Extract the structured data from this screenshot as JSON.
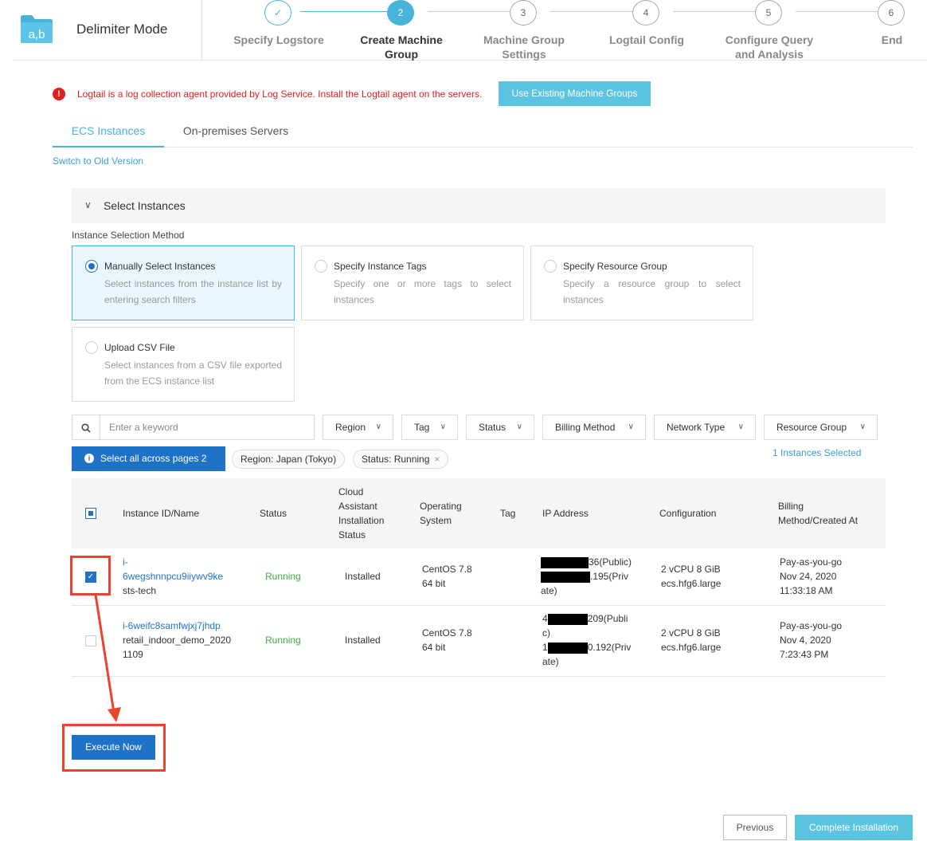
{
  "header": {
    "title": "Delimiter Mode",
    "logo_text": "a,b"
  },
  "steps": [
    {
      "num": "✓",
      "label": "Specify Logstore"
    },
    {
      "num": "2",
      "label": "Create Machine Group"
    },
    {
      "num": "3",
      "label": "Machine Group Settings"
    },
    {
      "num": "4",
      "label": "Logtail Config"
    },
    {
      "num": "5",
      "label": "Configure Query and Analysis"
    },
    {
      "num": "6",
      "label": "End"
    }
  ],
  "alert": {
    "icon": "!",
    "text": "Logtail is a log collection agent provided by Log Service. Install the Logtail agent on the servers.",
    "button": "Use Existing Machine Groups"
  },
  "tabs": [
    "ECS Instances",
    "On-premises Servers"
  ],
  "switch_link": "Switch to Old Version",
  "select_panel": {
    "title": "Select Instances",
    "method_label": "Instance Selection Method",
    "methods": [
      {
        "title": "Manually Select Instances",
        "desc": "Select instances from the instance list by entering search filters"
      },
      {
        "title": "Specify Instance Tags",
        "desc": "Specify one or more tags to select instances"
      },
      {
        "title": "Specify Resource Group",
        "desc": "Specify a resource group to select instances"
      },
      {
        "title": "Upload CSV File",
        "desc": "Select instances from a CSV file exported from the ECS instance list"
      }
    ]
  },
  "filters": {
    "search_placeholder": "Enter a keyword",
    "dropdowns": [
      "Region",
      "Tag",
      "Status",
      "Billing Method",
      "Network Type",
      "Resource Group"
    ]
  },
  "select_all_button": "Select all across pages 2",
  "chips": [
    "Region: Japan (Tokyo)",
    "Status: Running"
  ],
  "selected_count": "1 Instances Selected",
  "table": {
    "headers": {
      "id": "Instance ID/Name",
      "status": "Status",
      "cloud": "Cloud Assistant Installation Status",
      "os": "Operating System",
      "tag": "Tag",
      "ip": "IP Address",
      "config": "Configuration",
      "billing": "Billing Method/Created At"
    },
    "rows": [
      {
        "checked": true,
        "id_line1": "i-",
        "id_line2": "6wegshnnpcu9iiywv9ke",
        "name": "sts-tech",
        "status": "Running",
        "cloud": "Installed",
        "os_line1": "CentOS 7.8",
        "os_line2": "64 bit",
        "ip_line1": "36(Public)",
        "ip_line2": ".195(Priv",
        "ip_line3": "ate)",
        "cfg_line1": "2 vCPU 8 GiB",
        "cfg_line2": "ecs.hfg6.large",
        "bill_line1": "Pay-as-you-go",
        "bill_line2": "Nov 24, 2020",
        "bill_line3": "11:33:18 AM"
      },
      {
        "checked": false,
        "id_line1": "i-6weifc8samfwjxj7jhdp",
        "name_line1": "retail_indoor_demo_2020",
        "name_line2": "1109",
        "status": "Running",
        "cloud": "Installed",
        "os_line1": "CentOS 7.8",
        "os_line2": "64 bit",
        "ip_line1a": "4",
        "ip_line1b": "209(Publi",
        "ip_line2": "c)",
        "ip_line3a": "1",
        "ip_line3b": "0.192(Priv",
        "ip_line4": "ate)",
        "cfg_line1": "2 vCPU 8 GiB",
        "cfg_line2": "ecs.hfg6.large",
        "bill_line1": "Pay-as-you-go",
        "bill_line2": "Nov 4, 2020",
        "bill_line3": "7:23:43 PM"
      }
    ]
  },
  "execute_button": "Execute Now",
  "footer": {
    "previous": "Previous",
    "complete": "Complete Installation"
  },
  "colors": {
    "accent": "#4ab3d9",
    "primary": "#1e73c8",
    "error": "#e02020",
    "running": "#3fa73f",
    "annotation": "#e8452c"
  }
}
